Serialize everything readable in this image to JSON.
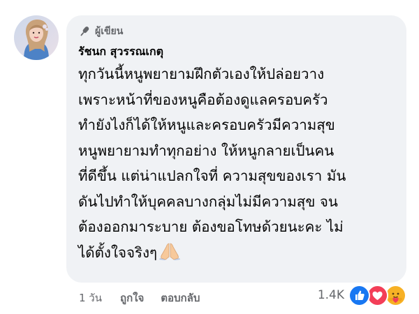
{
  "comment": {
    "badge_icon": "microphone-icon",
    "badge_label": "ผู้เขียน",
    "author": "รัชนก สุวรรณเกตุ",
    "lines": [
      "ทุกวันนี้หนูพยายามฝึกตัวเองให้ปล่อยวาง",
      "เพราะหน้าที่ของหนูคือต้องดูแลครอบครัว",
      "ทำยังไงก็ได้ให้หนูและครอบครัวมีความสุข",
      "หนูพยายามทำทุกอย่าง  ให้หนูกลายเป็นคน",
      "ที่ดีขึ้น  แต่น่าแปลกใจที่  ความสุขของเรา  มัน",
      "ดันไปทำให้บุคคลบางกลุ่มไม่มีความสุข  จน",
      "ต้องออกมาระบาย  ต้องขอโทษด้วยนะคะ  ไม่",
      "ได้ตั้งใจจริงๆ"
    ],
    "trailing_emoji": "folded-hands-emoji",
    "bubble_color": "#f0f2f5"
  },
  "actions": {
    "time": "1 วัน",
    "like": "ถูกใจ",
    "reply": "ตอบกลับ"
  },
  "reactions": {
    "count": "1.4K",
    "icons": [
      "like-reaction-icon",
      "love-reaction-icon",
      "care-reaction-icon"
    ],
    "colors": {
      "like": "#1877f2",
      "love": "#f33e58",
      "care": "#f7b125"
    }
  }
}
